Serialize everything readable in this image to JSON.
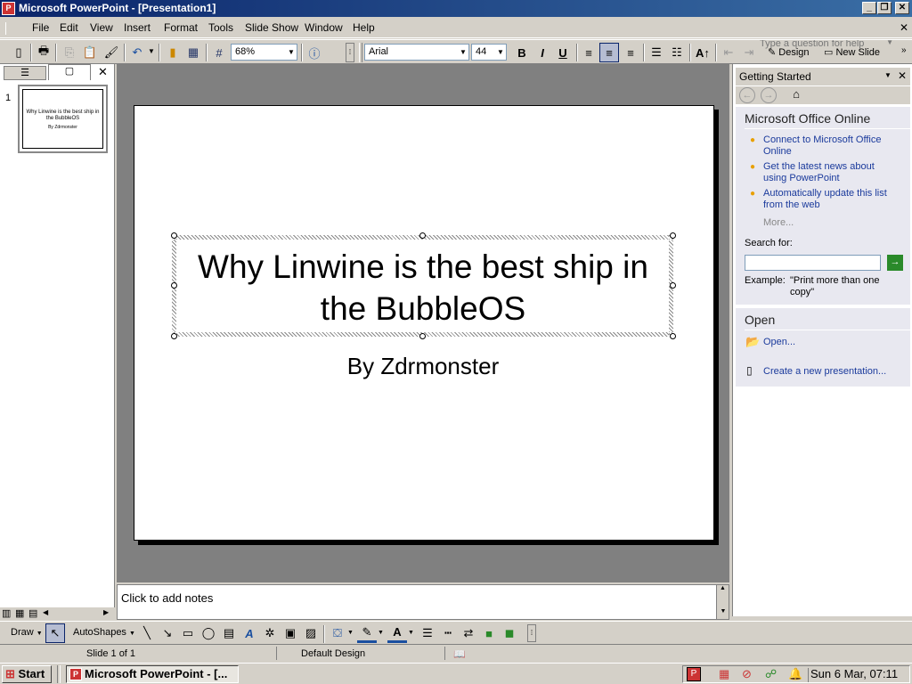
{
  "window": {
    "title": "Microsoft PowerPoint - [Presentation1]",
    "app_icon": "P"
  },
  "menu": [
    "File",
    "Edit",
    "View",
    "Insert",
    "Format",
    "Tools",
    "Slide Show",
    "Window",
    "Help"
  ],
  "help_placeholder": "Type a question for help",
  "toolbar": {
    "zoom": "68%",
    "font": "Arial",
    "font_size": "44",
    "bold": "B",
    "italic": "I",
    "underline": "U",
    "design_label": "Design",
    "new_slide_label": "New Slide"
  },
  "left_pane": {
    "slide_number": "1",
    "thumb_title": "Why Linwine is the best ship in the BubbleOS",
    "thumb_sub": "By Zdrmonster"
  },
  "slide": {
    "title": "Why Linwine is the best ship in the BubbleOS",
    "subtitle": "By Zdrmonster"
  },
  "notes_placeholder": "Click to add notes",
  "task_pane": {
    "title": "Getting Started",
    "office_online_heading": "Microsoft Office Online",
    "links": [
      "Connect to Microsoft Office Online",
      "Get the latest news about using PowerPoint",
      "Automatically update this list from the web"
    ],
    "more": "More...",
    "search_label": "Search for:",
    "example_label": "Example:",
    "example_text": "\"Print more than one copy\"",
    "open_heading": "Open",
    "open_link": "Open...",
    "create_link": "Create a new presentation..."
  },
  "drawbar": {
    "draw": "Draw",
    "autoshapes": "AutoShapes"
  },
  "status": {
    "slide": "Slide 1 of 1",
    "design": "Default Design"
  },
  "taskbar": {
    "start": "Start",
    "task": "Microsoft PowerPoint - [...",
    "clock": "Sun  6 Mar, 07:11"
  }
}
